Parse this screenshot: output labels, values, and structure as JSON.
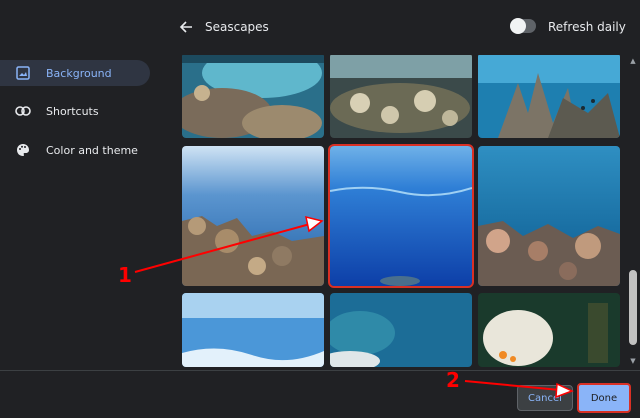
{
  "sidebar": {
    "items": [
      {
        "label": "Background",
        "icon": "image-icon",
        "active": true
      },
      {
        "label": "Shortcuts",
        "icon": "link-icon",
        "active": false
      },
      {
        "label": "Color and theme",
        "icon": "palette-icon",
        "active": false
      }
    ]
  },
  "header": {
    "back_icon": "arrow-left-icon",
    "title": "Seascapes",
    "refresh_daily_label": "Refresh daily",
    "refresh_daily_on": false
  },
  "gallery": {
    "selected_index": 4,
    "tiles": [
      {
        "name": "seascape-1"
      },
      {
        "name": "seascape-2"
      },
      {
        "name": "seascape-3"
      },
      {
        "name": "seascape-4"
      },
      {
        "name": "seascape-5"
      },
      {
        "name": "seascape-6"
      },
      {
        "name": "seascape-7"
      },
      {
        "name": "seascape-8"
      },
      {
        "name": "seascape-9"
      }
    ]
  },
  "footer": {
    "cancel_label": "Cancel",
    "done_label": "Done"
  },
  "annotations": {
    "marker_1": "1",
    "marker_2": "2",
    "color": "#ff0000"
  },
  "colors": {
    "accent": "#8ab4f8",
    "background": "#202124",
    "highlight": "#d93025"
  }
}
